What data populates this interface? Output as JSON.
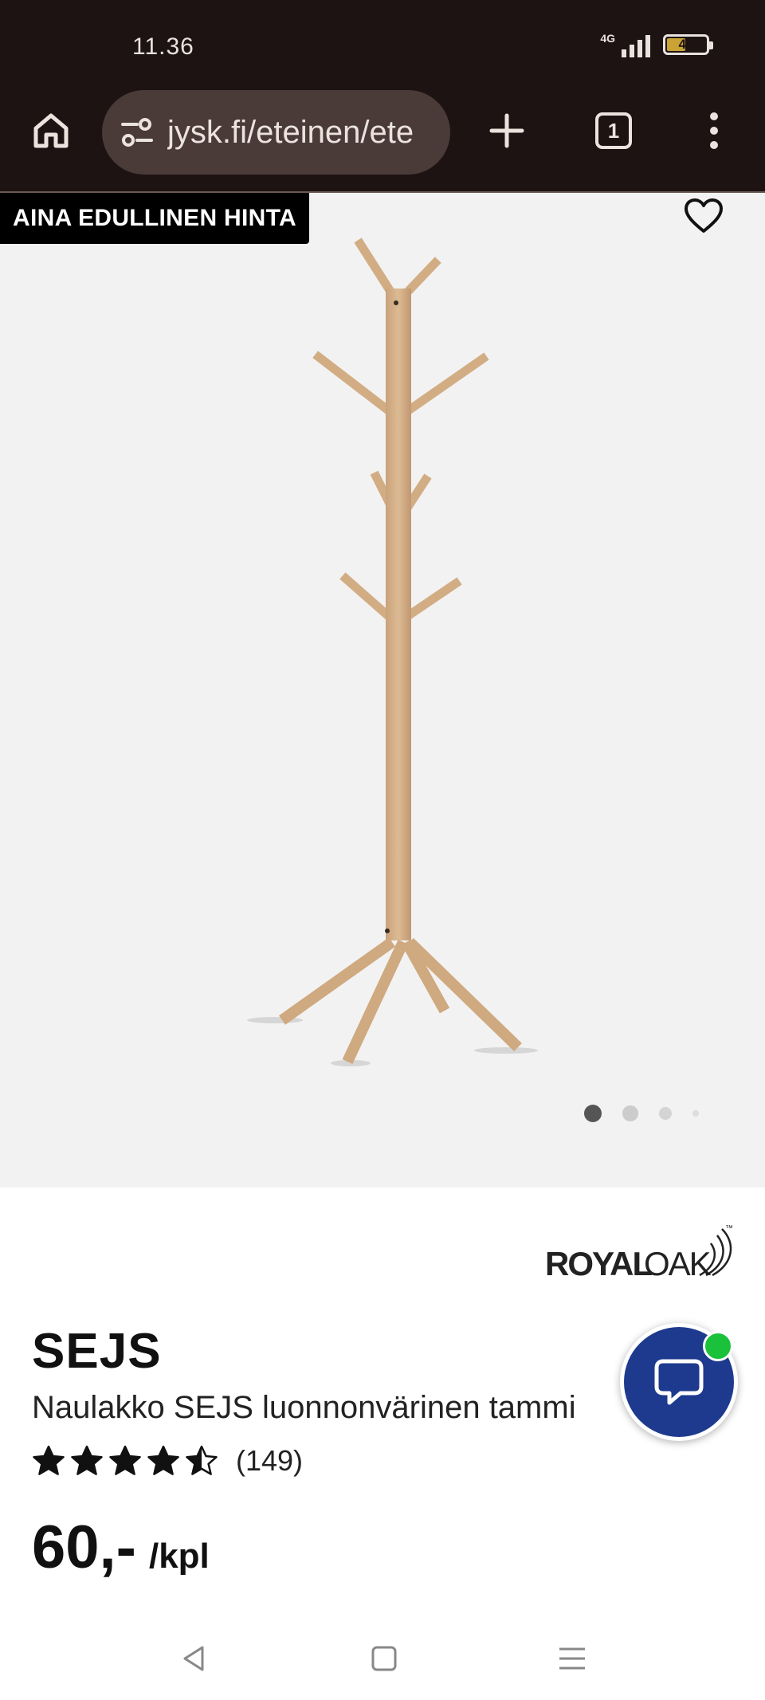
{
  "status_bar": {
    "time": "11.36",
    "network": "4G",
    "battery": "47",
    "battery_level": 0.47
  },
  "browser": {
    "url": "jysk.fi/eteinen/ete",
    "tab_count": "1",
    "icons": [
      "home-icon",
      "tune-icon",
      "plus-icon",
      "tabs-icon",
      "more-vert-icon"
    ]
  },
  "gallery": {
    "badge": "AINA EDULLINEN HINTA",
    "favorite_icon": "heart-outline-icon",
    "image_count": 4,
    "active_image": 1
  },
  "product": {
    "brand": "ROYALOAK",
    "brand_parts": [
      "ROYAL",
      "OAK"
    ],
    "trademark": "™",
    "name": "SEJS",
    "description": "Naulakko SEJS luonnonvärinen tammi",
    "rating": 4.5,
    "rating_max": 5,
    "review_count": "(149)",
    "price": "60,-",
    "unit": "/kpl"
  },
  "chat": {
    "icon": "chat-bubble-icon",
    "online": true,
    "online_color": "#19c23a"
  },
  "navbar": {
    "icons": [
      "back-icon",
      "home-square-icon",
      "recents-icon"
    ]
  },
  "colors": {
    "chrome_bg": "#1d1312",
    "url_bg": "#4a3b38",
    "gallery_bg": "#f2f2f2",
    "chat_bg": "#1d3a8e"
  }
}
